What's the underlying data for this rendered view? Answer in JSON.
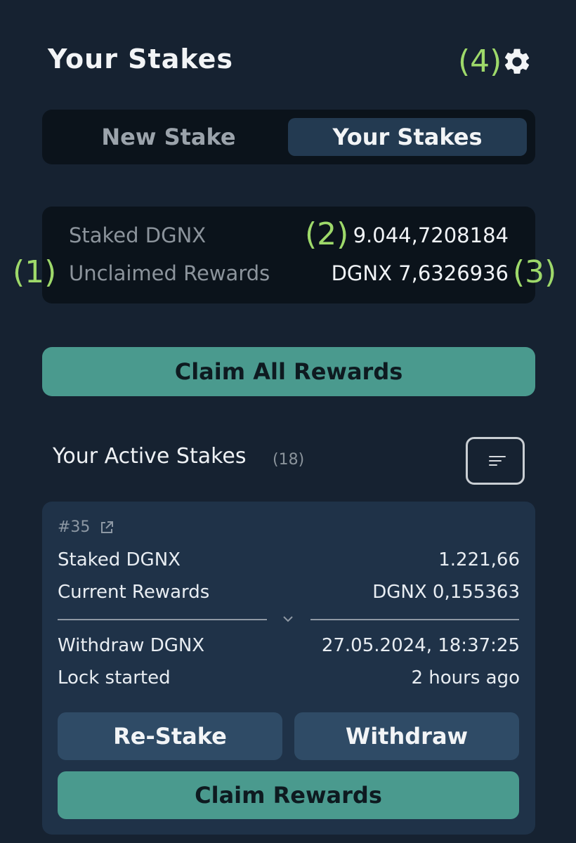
{
  "header": {
    "title": "Your Stakes",
    "settings_icon": "gear-icon"
  },
  "annotations": {
    "a1": "(1)",
    "a2": "(2)",
    "a3": "(3)",
    "a4": "(4)"
  },
  "tabs": [
    {
      "label": "New Stake",
      "active": false
    },
    {
      "label": "Your Stakes",
      "active": true
    }
  ],
  "summary": {
    "staked_label": "Staked DGNX",
    "staked_value": "9.044,7208184",
    "unclaimed_label": "Unclaimed Rewards",
    "unclaimed_value": "DGNX  7,6326936"
  },
  "claim_all_label": "Claim All Rewards",
  "active_stakes": {
    "title": "Your Active Stakes",
    "count": "(18)",
    "sort_icon": "sort-icon"
  },
  "stake_card": {
    "id": "#35",
    "id_icon": "external-link-icon",
    "rows_top": [
      {
        "label": "Staked DGNX",
        "value": "1.221,66"
      },
      {
        "label": "Current Rewards",
        "value": "DGNX   0,155363"
      }
    ],
    "rows_bottom": [
      {
        "label": "Withdraw DGNX",
        "value": "27.05.2024, 18:37:25"
      },
      {
        "label": "Lock started",
        "value": "2 hours ago"
      }
    ],
    "restake_label": "Re-Stake",
    "withdraw_label": "Withdraw",
    "claim_label": "Claim Rewards"
  },
  "colors": {
    "background": "#162231",
    "panel": "#0b131b",
    "card": "#1f3248",
    "accent": "#4a9a8e",
    "annotation": "#9ed96a"
  }
}
